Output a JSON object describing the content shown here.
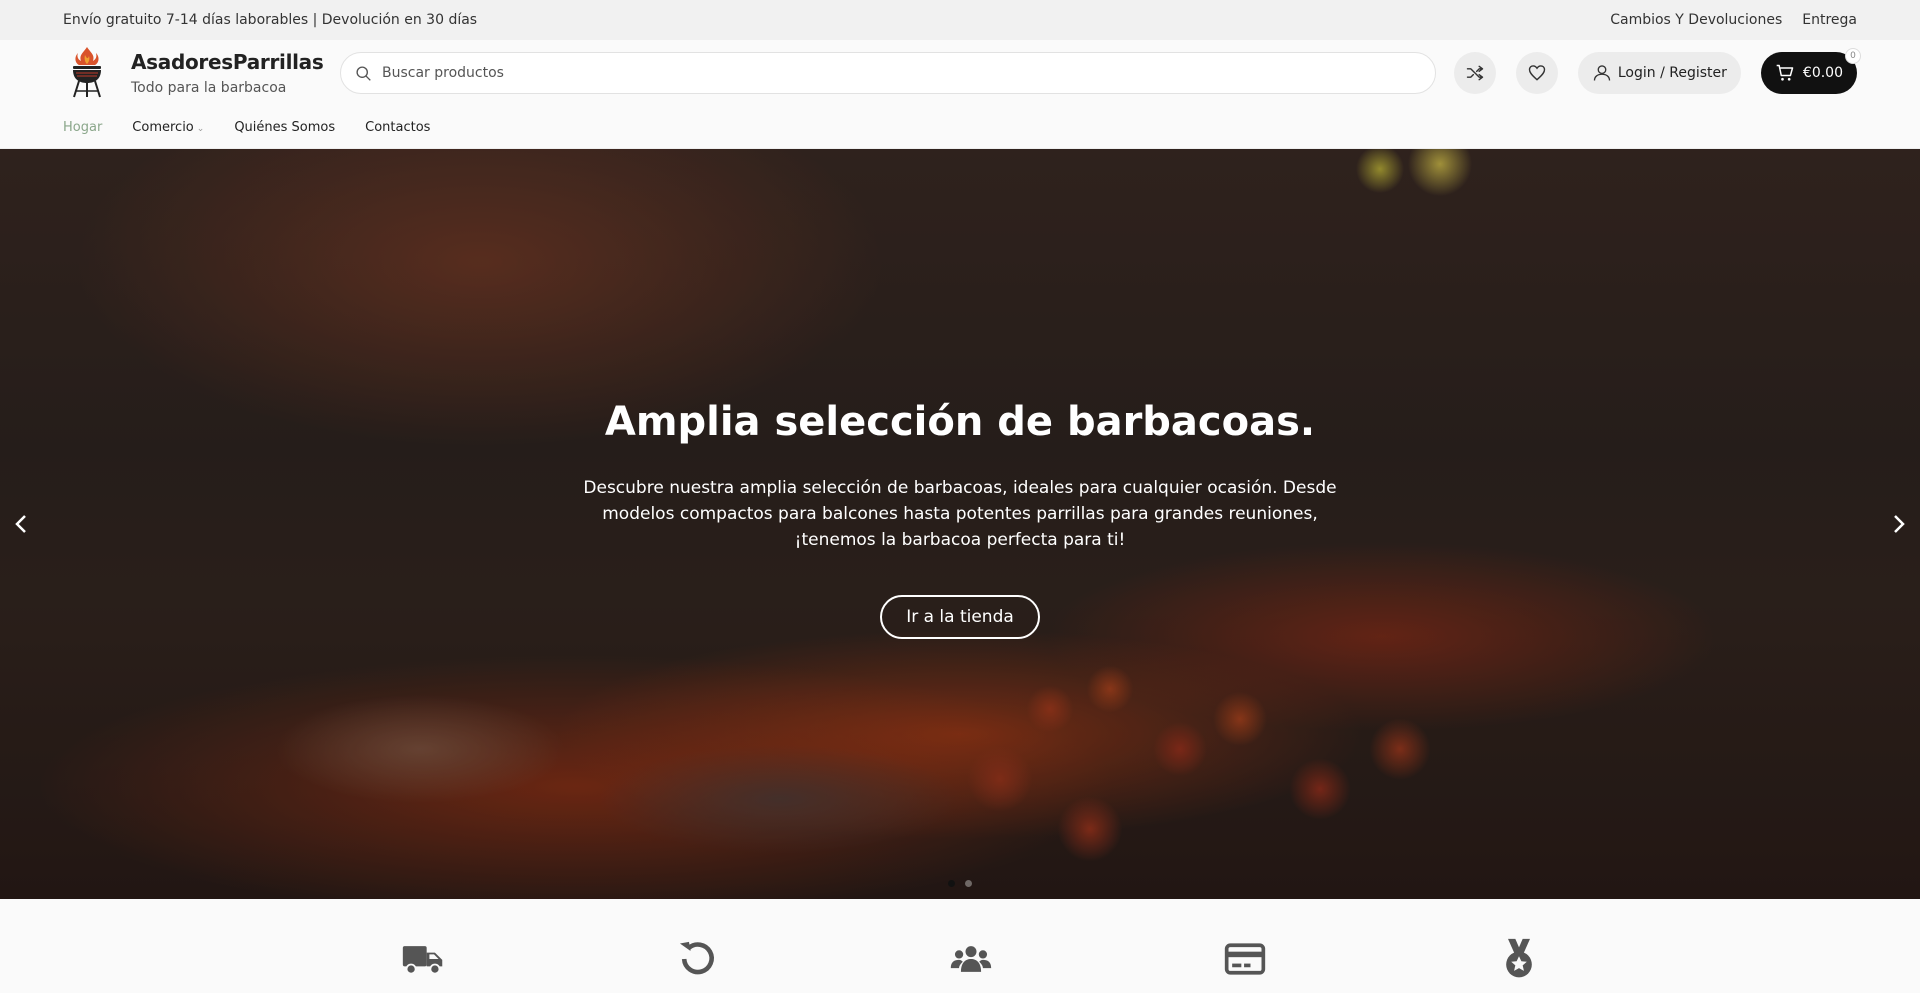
{
  "topbar": {
    "shipping_text": "Envío gratuito 7-14 días laborables | Devolución en 30 días",
    "links": [
      "Cambios Y Devoluciones",
      "Entrega"
    ]
  },
  "header": {
    "brand_name": "AsadoresParrillas",
    "brand_tagline": "Todo para la barbacoa",
    "search_placeholder": "Buscar productos",
    "login_label": "Login / Register",
    "cart_total": "€0.00",
    "cart_count": "0"
  },
  "nav": {
    "items": [
      "Hogar",
      "Comercio",
      "Quiénes Somos",
      "Contactos"
    ]
  },
  "hero": {
    "title": "Amplia selección de barbacoas.",
    "description": "Descubre nuestra amplia selección de barbacoas, ideales para cualquier ocasión. Desde modelos compactos para balcones hasta potentes parrillas para grandes reuniones, ¡tenemos la barbacoa perfecta para ti!",
    "button_label": "Ir a la tienda",
    "slide_count": 2,
    "active_slide": 1
  },
  "features": {
    "icons": [
      "truck-icon",
      "return-icon",
      "users-icon",
      "credit-card-icon",
      "medal-icon"
    ]
  },
  "colors": {
    "accent_nav_active": "#8aa68a",
    "cart_bg": "#111111"
  }
}
